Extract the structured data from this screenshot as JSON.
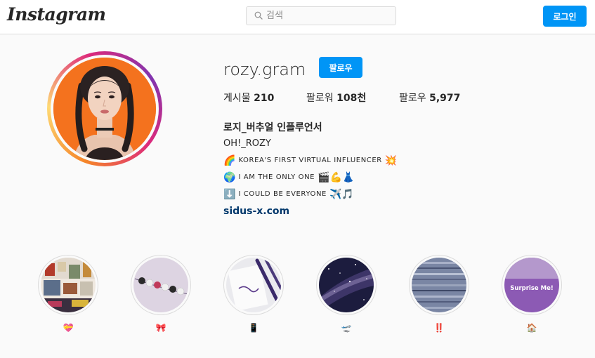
{
  "header": {
    "logo_text": "Instagram",
    "search_placeholder": "검색",
    "login_label": "로그인"
  },
  "profile": {
    "username": "rozy.gram",
    "follow_label": "팔로우",
    "stats": {
      "posts_label": "게시물",
      "posts_value": "210",
      "followers_label": "팔로워",
      "followers_value": "108천",
      "following_label": "팔로우",
      "following_value": "5,977"
    },
    "full_name": "로지_버추얼 인플루언서",
    "bio": {
      "line1": "OH!_ROZY",
      "line2_emoji_start": "🌈",
      "line2_text": "KOREA'S FIRST VIRTUAL INFLUENCER",
      "line2_emoji_end": "💥",
      "line3_emoji_start": "🌍",
      "line3_text": "I AM THE ONLY ONE",
      "line3_emoji_end": "🎬💪👗",
      "line4_emoji_start": "⬇️",
      "line4_text": "I COULD BE EVERYONE",
      "line4_emoji_end": "✈️🎵"
    },
    "website": "sidus-x.com"
  },
  "highlights": [
    {
      "label": "💝",
      "image": "room-collage"
    },
    {
      "label": "🎀",
      "image": "rozy-bracelet"
    },
    {
      "label": "📱",
      "image": "rozy-notebook"
    },
    {
      "label": "🛫",
      "image": "galaxy"
    },
    {
      "label": "‼️",
      "image": "tv-static"
    },
    {
      "label": "🏠",
      "image": "surprise-me",
      "image_text": "Surprise Me!"
    }
  ],
  "colors": {
    "accent": "#0095f6",
    "link": "#00376b",
    "background": "#fafafa",
    "border": "#dbdbdb"
  }
}
